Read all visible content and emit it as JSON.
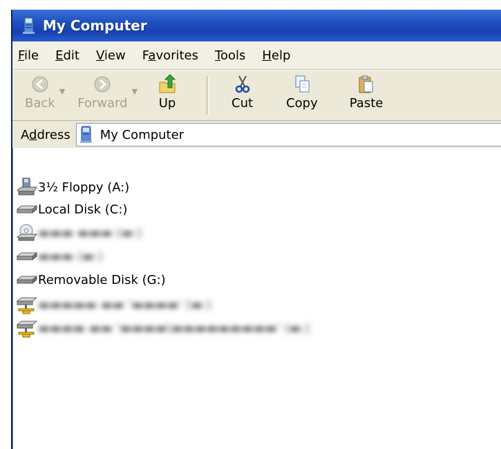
{
  "window": {
    "title": "My Computer"
  },
  "menu": [
    "File",
    "Edit",
    "View",
    "Favorites",
    "Tools",
    "Help"
  ],
  "toolbar": {
    "back": "Back",
    "forward": "Forward",
    "up": "Up",
    "cut": "Cut",
    "copy": "Copy",
    "paste": "Paste"
  },
  "address": {
    "label": "Address",
    "value": "My Computer"
  },
  "drives": [
    {
      "label": "3½ Floppy (A:)",
      "icon": "floppy-drive-icon"
    },
    {
      "label": "Local Disk (C:)",
      "icon": "hard-disk-icon"
    },
    {
      "label": "",
      "icon": "cd-drive-icon",
      "obscured": true
    },
    {
      "label": "",
      "icon": "hard-disk-icon",
      "obscured": true
    },
    {
      "label": "Removable Disk (G:)",
      "icon": "removable-disk-icon"
    },
    {
      "label": "",
      "icon": "network-drive-icon",
      "obscured": true
    },
    {
      "label": "",
      "icon": "network-drive-icon",
      "obscured": true
    }
  ],
  "colors": {
    "title_bar": "#1f4fbf",
    "chrome": "#ece9d8",
    "content": "#ffffff"
  }
}
